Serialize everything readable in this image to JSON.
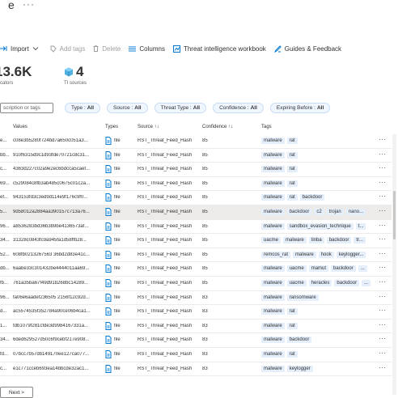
{
  "header": {
    "title_char": "e",
    "more": "···"
  },
  "toolbar": {
    "items": [
      {
        "label": "Import",
        "icon": "import-icon",
        "enabled": true
      },
      {
        "label": "Add tags",
        "icon": "tag-icon",
        "enabled": false
      },
      {
        "label": "Delete",
        "icon": "trash-icon",
        "enabled": false
      },
      {
        "label": "Columns",
        "icon": "columns-icon",
        "enabled": true
      },
      {
        "label": "Threat intelligence workbook",
        "icon": "workbook-icon",
        "enabled": true
      },
      {
        "label": "Guides & Feedback",
        "icon": "guides-icon",
        "enabled": true
      }
    ]
  },
  "stats": {
    "indicators": {
      "value": "13.6K",
      "label": "cators"
    },
    "sources": {
      "value": "4",
      "label": "TI sources"
    }
  },
  "filters": {
    "search_placeholder": "scription or tags",
    "pills": [
      {
        "name": "Type :",
        "value": "All"
      },
      {
        "name": "Source :",
        "value": "All"
      },
      {
        "name": "Threat Type :",
        "value": "All"
      },
      {
        "name": "Confidence :",
        "value": "All"
      },
      {
        "name": "Expiring Before :",
        "value": "All"
      }
    ]
  },
  "table": {
    "columns": [
      "Values",
      "Types",
      "Source ↑↓",
      "Confidence ↑↓",
      "Tags"
    ],
    "rows": [
      {
        "pre": "e...",
        "value": "c08e3b5280f724bd7a650c051a3...",
        "type": "file",
        "source": "RST_Threat_Feed_Hash",
        "confidence": "85",
        "tags": [
          "malware",
          "rat"
        ]
      },
      {
        "pre": "bb...",
        "value": "910f6315d9c1d93fde70721c8c31...",
        "type": "file",
        "source": "RST_Threat_Feed_Hash",
        "confidence": "85",
        "tags": [
          "malware",
          "rat"
        ]
      },
      {
        "pre": "c...",
        "value": "4363d227c02a9e2ec6bdcca5caef...",
        "type": "file",
        "source": "RST_Threat_Feed_Hash",
        "confidence": "85",
        "tags": [
          "malware",
          "rat"
        ]
      },
      {
        "pre": "69...",
        "value": "c529084c8fb3ab485c0675c01c2a...",
        "type": "file",
        "source": "RST_Threat_Feed_Hash",
        "confidence": "85",
        "tags": [
          "malware",
          "rat"
        ]
      },
      {
        "pre": "ef...",
        "value": "943153fd3c3ed9d114e9f176c9f0...",
        "type": "file",
        "source": "RST_Threat_Feed_Hash",
        "confidence": "85",
        "tags": [
          "malware",
          "rat",
          "backdoor"
        ]
      },
      {
        "pre": "5...",
        "value": "9d58012a2884aa390157c713a76...",
        "type": "file",
        "source": "RST_Threat_Feed_Hash",
        "confidence": "85",
        "tags": [
          "malware",
          "backdoor",
          "c2",
          "trojan",
          "nano..."
        ],
        "selected": true
      },
      {
        "pre": "96...",
        "value": "a8536283bd36b3b9be4136573af...",
        "type": "file",
        "source": "RST_Threat_Feed_Hash",
        "confidence": "85",
        "tags": [
          "malware",
          "sandbox_evasion_technique",
          "t..."
        ]
      },
      {
        "pre": "34...",
        "value": "31328c0843fc9a945fa1d58ffb28...",
        "type": "file",
        "source": "RST_Threat_Feed_Hash",
        "confidence": "85",
        "tags": [
          "uacme",
          "malware",
          "tinba",
          "backdoor",
          "tr..."
        ]
      },
      {
        "pre": "52...",
        "value": "608fb0213267563 36bd2d83e41c...",
        "type": "file",
        "source": "RST_Threat_Feed_Hash",
        "confidence": "85",
        "tags": [
          "remcos_rat",
          "malware",
          "hook",
          "keylogger..."
        ]
      },
      {
        "pre": "db...",
        "value": "6aabe33c301432be4444011aa69...",
        "type": "file",
        "source": "RST_Threat_Feed_Hash",
        "confidence": "85",
        "tags": [
          "malware",
          "uacme",
          "mamut",
          "backdoor",
          "..."
        ]
      },
      {
        "pre": "fb...",
        "value": "761a35ba67f49d91b268bc14289...",
        "type": "file",
        "source": "RST_Threat_Feed_Hash",
        "confidence": "85",
        "tags": [
          "malware",
          "uacme",
          "heracles",
          "backdoor",
          "..."
        ]
      },
      {
        "pre": "96...",
        "value": "fa06e6aadef236505 2156f12c92d...",
        "type": "file",
        "source": "RST_Threat_Feed_Hash",
        "confidence": "83",
        "tags": [
          "malware",
          "ransomware"
        ]
      },
      {
        "pre": "d...",
        "value": "ac5574535f352784a90ce06b4ca1...",
        "type": "file",
        "source": "RST_Threat_Feed_Hash",
        "confidence": "83",
        "tags": [
          "malware",
          "rat"
        ]
      },
      {
        "pre": "1...",
        "value": "fdb1079f281cfde3d9984167331a...",
        "type": "file",
        "source": "RST_Threat_Feed_Hash",
        "confidence": "83",
        "tags": [
          "malware",
          "rat"
        ]
      },
      {
        "pre": "34...",
        "value": "6ded629527d50c6f9cebf217e908...",
        "type": "file",
        "source": "RST_Threat_Feed_Hash",
        "confidence": "83",
        "tags": [
          "malware",
          "backdoor"
        ]
      },
      {
        "pre": "fd...",
        "value": "07bcc7b57db149170ee127ca077...",
        "type": "file",
        "source": "RST_Threat_Feed_Hash",
        "confidence": "83",
        "tags": [
          "malware",
          "rat"
        ]
      },
      {
        "pre": "c...",
        "value": "e1c771cceb693ea14bbcde32ac1...",
        "type": "file",
        "source": "RST_Threat_Feed_Hash",
        "confidence": "83",
        "tags": [
          "malware",
          "keylogger"
        ]
      }
    ],
    "row_more": "···"
  },
  "pager": {
    "next_label": "Next >"
  },
  "colors": {
    "accent": "#0078d4",
    "tag_bg": "#e5eefb",
    "selected_row": "#edebe9"
  }
}
